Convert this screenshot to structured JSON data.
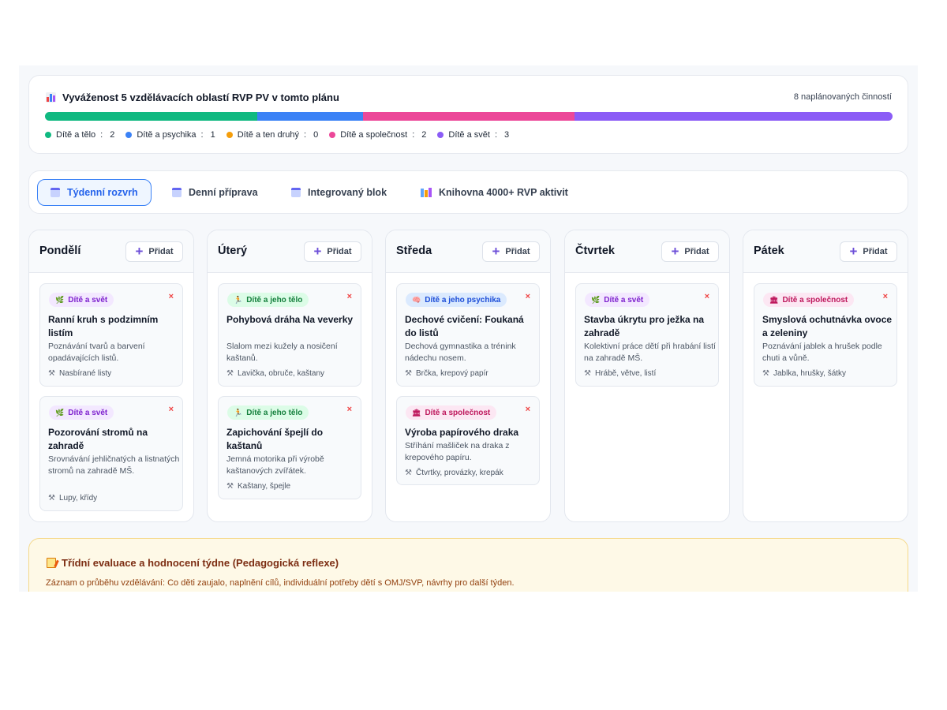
{
  "balance": {
    "title": "Vyváženost 5 vzdělávacích oblastí RVP PV v tomto plánu",
    "count_label": "8 naplánovaných činností",
    "segments": [
      {
        "label": "Dítě a tělo",
        "value": 2,
        "color": "#10b981"
      },
      {
        "label": "Dítě a psychika",
        "value": 1,
        "color": "#3b82f6"
      },
      {
        "label": "Dítě a ten druhý",
        "value": 0,
        "color": "#f59e0b"
      },
      {
        "label": "Dítě a společnost",
        "value": 2,
        "color": "#ec4899"
      },
      {
        "label": "Dítě a svět",
        "value": 3,
        "color": "#8b5cf6"
      }
    ]
  },
  "tabs": [
    {
      "label": "Týdenní rozvrh",
      "icon": "calendar-icon",
      "active": true
    },
    {
      "label": "Denní příprava",
      "icon": "calendar-icon",
      "active": false
    },
    {
      "label": "Integrovaný blok",
      "icon": "calendar-icon",
      "active": false
    },
    {
      "label": "Knihovna 4000+ RVP aktivit",
      "icon": "books-icon",
      "active": false
    }
  ],
  "add_label": "Přidat",
  "days": [
    {
      "name": "Pondělí",
      "activities": [
        {
          "tag": "Dítě a svět",
          "tag_icon": "seedling-icon",
          "title": "Ranní kruh s podzimním listím",
          "desc": "Poznávání tvarů a barvení opadávajících listů.",
          "materials": "Nasbírané listy"
        },
        {
          "tag": "Dítě a svět",
          "tag_icon": "seedling-icon",
          "title": "Pozorování stromů na zahradě",
          "desc": "Srovnávání jehličnatých a listnatých stromů na zahradě MŠ.",
          "materials": "Lupy, křídy"
        }
      ]
    },
    {
      "name": "Úterý",
      "activities": [
        {
          "tag": "Dítě a jeho tělo",
          "tag_icon": "running-icon",
          "title": "Pohybová dráha Na veverky",
          "desc": "Slalom mezi kužely a nosičení kaštanů.",
          "materials": "Lavička, obruče, kaštany"
        },
        {
          "tag": "Dítě a jeho tělo",
          "tag_icon": "running-icon",
          "title": "Zapichování špejlí do kaštanů",
          "desc": "Jemná motorika při výrobě kaštanových zvířátek.",
          "materials": "Kaštany, špejle"
        }
      ]
    },
    {
      "name": "Středa",
      "activities": [
        {
          "tag": "Dítě a jeho psychika",
          "tag_icon": "brain-icon",
          "title": "Dechové cvičení: Foukaná do listů",
          "desc": "Dechová gymnastika a trénink nádechu nosem.",
          "materials": "Brčka, krepový papír"
        },
        {
          "tag": "Dítě a společnost",
          "tag_icon": "building-icon",
          "title": "Výroba papírového draka",
          "desc": "Stříhání mašliček na draka z krepového papíru.",
          "materials": "Čtvrtky, provázky, krepák"
        }
      ]
    },
    {
      "name": "Čtvrtek",
      "activities": [
        {
          "tag": "Dítě a svět",
          "tag_icon": "seedling-icon",
          "title": "Stavba úkrytu pro ježka na zahradě",
          "desc": "Kolektivní práce dětí při hrabání listí na zahradě MŠ.",
          "materials": "Hrábě, větve, listí"
        }
      ]
    },
    {
      "name": "Pátek",
      "activities": [
        {
          "tag": "Dítě a společnost",
          "tag_icon": "building-icon",
          "title": "Smyslová ochutnávka ovoce a zeleniny",
          "desc": "Poznávání jablek a hrušek podle chuti a vůně.",
          "materials": "Jablka, hrušky, šátky"
        }
      ]
    }
  ],
  "reflection": {
    "title": "Třídní evaluace a hodnocení týdne (Pedagogická reflexe)",
    "desc": "Záznam o průběhu vzdělávání: Co děti zaujalo, naplnění cílů, individuální potřeby dětí s OMJ/SVP, návrhy pro další týden."
  },
  "tag_styles": {
    "Dítě a svět": {
      "bg": "#f3e8ff",
      "fg": "#7e22ce"
    },
    "Dítě a jeho tělo": {
      "bg": "#dcfce7",
      "fg": "#15803d"
    },
    "Dítě a jeho psychika": {
      "bg": "#dbeafe",
      "fg": "#1d4ed8"
    },
    "Dítě a společnost": {
      "bg": "#fce7f3",
      "fg": "#be185d"
    }
  }
}
